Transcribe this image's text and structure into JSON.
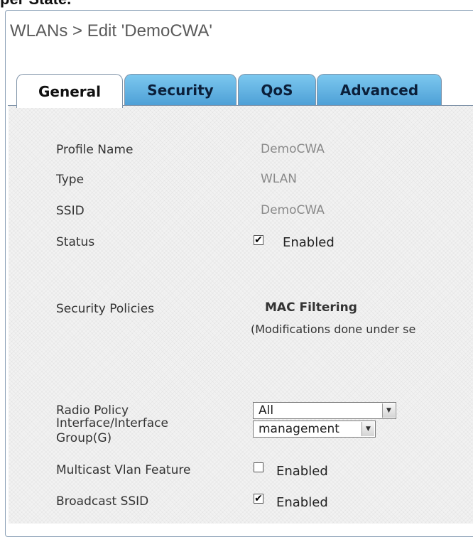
{
  "cropped_heading": "per State.",
  "page_title": "WLANs > Edit  'DemoCWA'",
  "tabs": [
    {
      "label": "General",
      "active": true
    },
    {
      "label": "Security",
      "active": false
    },
    {
      "label": "QoS",
      "active": false
    },
    {
      "label": "Advanced",
      "active": false
    }
  ],
  "general": {
    "profile_name_label": "Profile Name",
    "profile_name_value": "DemoCWA",
    "type_label": "Type",
    "type_value": "WLAN",
    "ssid_label": "SSID",
    "ssid_value": "DemoCWA",
    "status_label": "Status",
    "status_checked": true,
    "status_text": "Enabled",
    "security_policies_label": "Security Policies",
    "security_policies_value": "MAC Filtering",
    "security_policies_note": "(Modifications done under se",
    "radio_policy_label": "Radio Policy",
    "radio_policy_value": "All",
    "interface_label_line1": "Interface/Interface",
    "interface_label_line2": "Group(G)",
    "interface_value": "management",
    "multicast_label": "Multicast Vlan Feature",
    "multicast_checked": false,
    "multicast_text": "Enabled",
    "broadcast_label": "Broadcast SSID",
    "broadcast_checked": true,
    "broadcast_text": "Enabled"
  },
  "colors": {
    "tab_blue": "#5fb1e3",
    "frame_border": "#8aa0b6",
    "value_gray": "#8a8a8a"
  },
  "icons": {
    "checkmark": "check-icon",
    "dropdown": "chevron-down-icon"
  }
}
